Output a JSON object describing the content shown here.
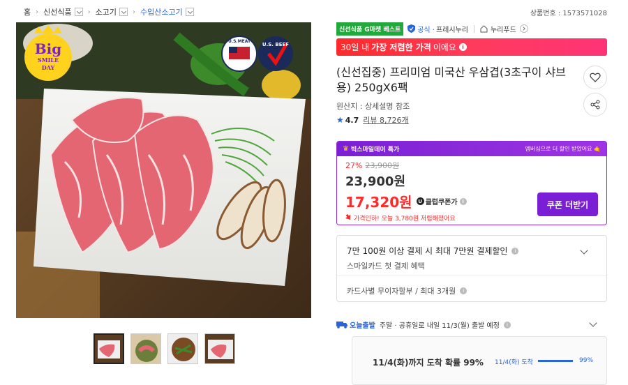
{
  "breadcrumb": {
    "items": [
      {
        "label": "홈"
      },
      {
        "label": "신선식품"
      },
      {
        "label": "소고기"
      },
      {
        "label": "수입산소고기"
      }
    ]
  },
  "product_no": "상품번호 : 1573571028",
  "main_image": {
    "badge_line1": "Big",
    "badge_line2": "SMILE",
    "badge_line3": "DAY",
    "usmeat_label": "U.S.MEAT",
    "usbeef_label": "U.S. BEEF"
  },
  "thumbnails": [
    {
      "name": "thumbnail-1",
      "selected": true
    },
    {
      "name": "thumbnail-2",
      "selected": false
    },
    {
      "name": "thumbnail-3",
      "selected": false
    },
    {
      "name": "thumbnail-4",
      "selected": false
    }
  ],
  "badges": {
    "gmarket_best": "신선식품 G마켓 베스트",
    "official": "공식 ·",
    "official_brand": "프레시누리",
    "store": "누리푸드"
  },
  "lowest_banner": {
    "pre": "30일 내",
    "bold": "가장 저렴한 가격",
    "post": "이에요",
    "info": "i"
  },
  "title": "(신선집중) 프리미엄 미국산 우삼겹(3초구이 샤브용) 250gX6팩",
  "origin": "원산지 : 상세설명 참조",
  "rating": {
    "score": "4.7",
    "reviews": "리뷰 8,726개"
  },
  "promo": {
    "header": "빅스마일데이 특가",
    "header_right": "멤버십으로 더 할인 받았어요 🤙",
    "discount": "27%",
    "original_price": "23,900원",
    "price": "23,900원",
    "coupon_price": "17,320원",
    "club_label": "클럽쿠폰가",
    "club_u": "U",
    "drop_text": "가격인하! 오늘 3,780원 저렴해졌어요",
    "coupon_button": "쿠폰 더받기"
  },
  "card_benefit": {
    "line1": "7만 100원 이상 결제 시 최대 7만원 결제할인",
    "line2": "스마일카드 첫 결제 혜택",
    "line3": "카드사별 무이자할부 / 최대 3개월"
  },
  "delivery": {
    "today": "오늘출발",
    "desc": "주말 · 공휴일로 내일 11/3(월) 출발 예정"
  },
  "arrival": {
    "text": "11/4(화)까지 도착 확률 99%",
    "label": "11/4(화) 도착",
    "percent_label": "99%",
    "progress": 0.99
  },
  "colors": {
    "accent_blue": "#2b63d9",
    "red": "#ff2a2a",
    "purple": "#7b1fd6",
    "green_badge": "#22a93b"
  }
}
